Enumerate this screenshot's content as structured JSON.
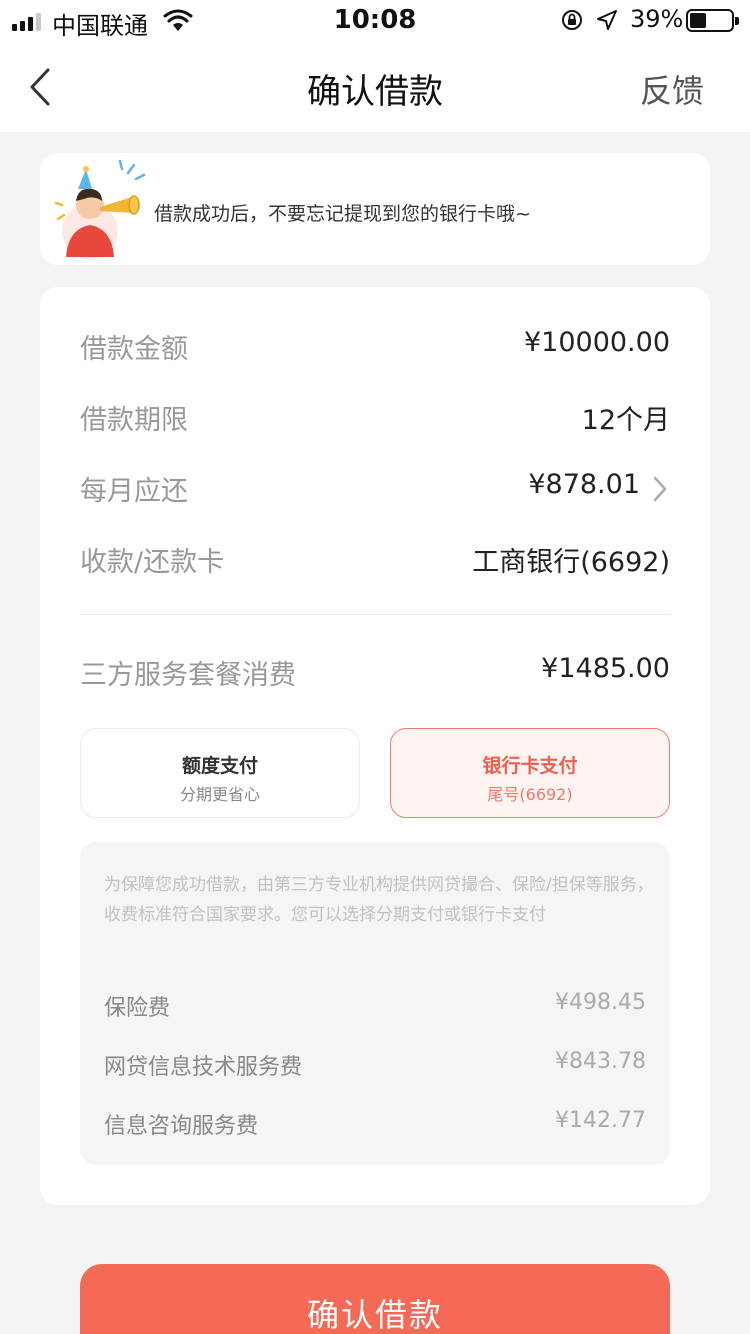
{
  "status_bar": {
    "carrier": "中国联通",
    "time": "10:08",
    "battery_percent": "39%"
  },
  "nav": {
    "title": "确认借款",
    "feedback": "反馈"
  },
  "tip": {
    "text": "借款成功后，不要忘记提现到您的银行卡哦~"
  },
  "loan_details": {
    "rows": [
      {
        "label": "借款金额",
        "value": "¥10000.00"
      },
      {
        "label": "借款期限",
        "value": "12个月"
      },
      {
        "label": "每月应还",
        "value": "¥878.01"
      },
      {
        "label": "收款/还款卡",
        "value": "工商银行(6692)"
      }
    ],
    "service_fee": {
      "label": "三方服务套餐消费",
      "value": "¥1485.00"
    }
  },
  "payment_options": [
    {
      "title": "额度支付",
      "subtitle": "分期更省心",
      "selected": false
    },
    {
      "title": "银行卡支付",
      "subtitle": "尾号(6692)",
      "selected": true
    }
  ],
  "fee_breakdown": {
    "note": "为保障您成功借款，由第三方专业机构提供网贷撮合、保险/担保等服务，收费标准符合国家要求。您可以选择分期支付或银行卡支付",
    "items": [
      {
        "label": "保险费",
        "value": "¥498.45"
      },
      {
        "label": "网贷信息技术服务费",
        "value": "¥843.78"
      },
      {
        "label": "信息咨询服务费",
        "value": "¥142.77"
      }
    ]
  },
  "confirm_button": {
    "label": "确认借款"
  },
  "colors": {
    "accent": "#f56a56",
    "background": "#f4f4f6"
  }
}
